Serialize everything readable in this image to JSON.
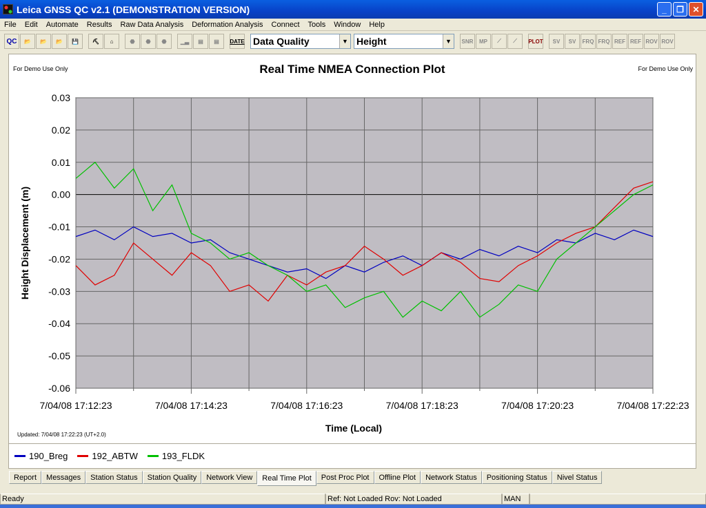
{
  "window": {
    "title": "Leica GNSS QC v2.1 (DEMONSTRATION VERSION)"
  },
  "menu": [
    "File",
    "Edit",
    "Automate",
    "Results",
    "Raw Data Analysis",
    "Deformation Analysis",
    "Connect",
    "Tools",
    "Window",
    "Help"
  ],
  "toolbar": {
    "qc": "QC",
    "date": "DATE",
    "plot": "PLOT",
    "combo1": "Data Quality",
    "combo2": "Height",
    "right_buttons": [
      "SV",
      "SV",
      "FRQ",
      "FRQ",
      "REF",
      "REF",
      "ROV",
      "ROV"
    ],
    "snr": "SNR",
    "mp": "MP"
  },
  "panel": {
    "demo_left": "For Demo Use Only",
    "demo_right": "For Demo Use Only",
    "updated": "Updated: 7/04/08 17:22:23 (UT+2.0)"
  },
  "tabs": [
    "Report",
    "Messages",
    "Station Status",
    "Station Quality",
    "Network View",
    "Real Time Plot",
    "Post Proc Plot",
    "Offline Plot",
    "Network Status",
    "Positioning Status",
    "Nivel Status"
  ],
  "active_tab": "Real Time Plot",
  "status": {
    "ready": "Ready",
    "refrov": "Ref: Not Loaded Rov: Not Loaded",
    "mode": "MAN"
  },
  "chart_data": {
    "type": "line",
    "title": "Real Time NMEA Connection Plot",
    "xlabel": "Time (Local)",
    "ylabel": "Height Displacement (m)",
    "ylim": [
      -0.06,
      0.03
    ],
    "yticks": [
      "0.03",
      "0.02",
      "0.01",
      "0.00",
      "-0.01",
      "-0.02",
      "-0.03",
      "-0.04",
      "-0.05",
      "-0.06"
    ],
    "xlim": [
      "17:12:23",
      "17:22:23"
    ],
    "xticks": [
      "7/04/08 17:12:23",
      "7/04/08 17:14:23",
      "7/04/08 17:16:23",
      "7/04/08 17:18:23",
      "7/04/08 17:20:23",
      "7/04/08 17:22:23"
    ],
    "grid": true,
    "plot_background": "#c0bdc3",
    "legend_placement": "bottom",
    "x": [
      "17:12:23",
      "17:12:43",
      "17:13:03",
      "17:13:23",
      "17:13:43",
      "17:14:03",
      "17:14:23",
      "17:14:43",
      "17:15:03",
      "17:15:23",
      "17:15:43",
      "17:16:03",
      "17:16:23",
      "17:16:43",
      "17:17:03",
      "17:17:23",
      "17:17:43",
      "17:18:03",
      "17:18:23",
      "17:18:43",
      "17:19:03",
      "17:19:23",
      "17:19:43",
      "17:20:03",
      "17:20:23",
      "17:20:43",
      "17:21:03",
      "17:21:23",
      "17:21:43",
      "17:22:03",
      "17:22:23"
    ],
    "series": [
      {
        "name": "190_Breg",
        "color": "#0000c0",
        "values": [
          -0.013,
          -0.011,
          -0.014,
          -0.01,
          -0.013,
          -0.012,
          -0.015,
          -0.014,
          -0.018,
          -0.02,
          -0.022,
          -0.024,
          -0.023,
          -0.026,
          -0.022,
          -0.024,
          -0.021,
          -0.019,
          -0.022,
          -0.018,
          -0.02,
          -0.017,
          -0.019,
          -0.016,
          -0.018,
          -0.014,
          -0.015,
          -0.012,
          -0.014,
          -0.011,
          -0.013
        ]
      },
      {
        "name": "192_ABTW",
        "color": "#e00000",
        "values": [
          -0.022,
          -0.028,
          -0.025,
          -0.015,
          -0.02,
          -0.025,
          -0.018,
          -0.022,
          -0.03,
          -0.028,
          -0.033,
          -0.025,
          -0.028,
          -0.024,
          -0.022,
          -0.016,
          -0.02,
          -0.025,
          -0.022,
          -0.018,
          -0.021,
          -0.026,
          -0.027,
          -0.022,
          -0.019,
          -0.015,
          -0.012,
          -0.01,
          -0.004,
          0.002,
          0.004
        ]
      },
      {
        "name": "193_FLDK",
        "color": "#00c000",
        "values": [
          0.005,
          0.01,
          0.002,
          0.008,
          -0.005,
          0.003,
          -0.012,
          -0.015,
          -0.02,
          -0.018,
          -0.022,
          -0.025,
          -0.03,
          -0.028,
          -0.035,
          -0.032,
          -0.03,
          -0.038,
          -0.033,
          -0.036,
          -0.03,
          -0.038,
          -0.034,
          -0.028,
          -0.03,
          -0.02,
          -0.015,
          -0.01,
          -0.005,
          0.0,
          0.003
        ]
      }
    ]
  }
}
